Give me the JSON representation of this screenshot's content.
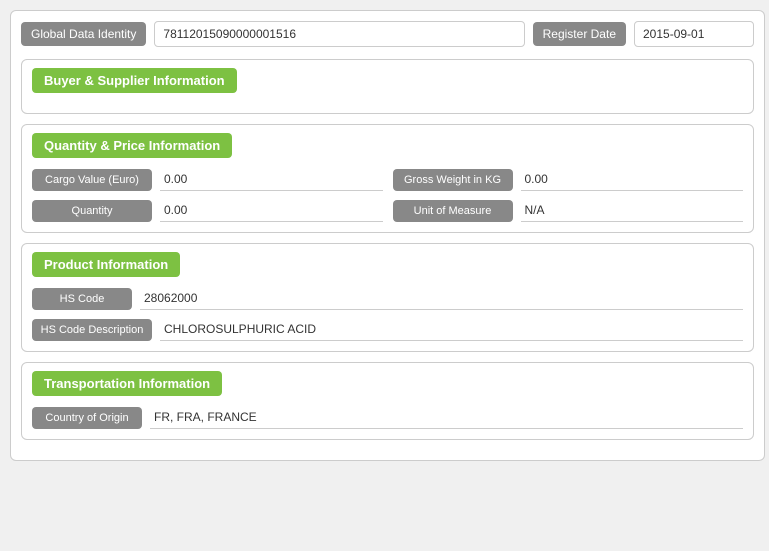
{
  "header": {
    "gdi_label": "Global Data Identity",
    "gdi_value": "78112015090000001516",
    "register_label": "Register Date",
    "register_value": "2015-09-01"
  },
  "sections": {
    "buyer_supplier": {
      "title": "Buyer & Supplier Information"
    },
    "quantity_price": {
      "title": "Quantity & Price Information",
      "fields": {
        "cargo_value_label": "Cargo Value (Euro)",
        "cargo_value": "0.00",
        "gross_weight_label": "Gross Weight in KG",
        "gross_weight": "0.00",
        "quantity_label": "Quantity",
        "quantity": "0.00",
        "unit_of_measure_label": "Unit of Measure",
        "unit_of_measure": "N/A"
      }
    },
    "product": {
      "title": "Product Information",
      "fields": {
        "hs_code_label": "HS Code",
        "hs_code": "28062000",
        "hs_code_desc_label": "HS Code Description",
        "hs_code_desc": "CHLOROSULPHURIC ACID"
      }
    },
    "transportation": {
      "title": "Transportation Information",
      "fields": {
        "country_origin_label": "Country of Origin",
        "country_origin": "FR, FRA, FRANCE"
      }
    }
  }
}
